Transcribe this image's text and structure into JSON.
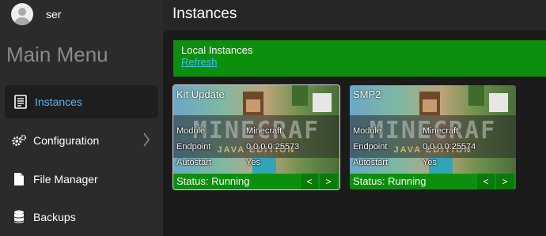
{
  "user": {
    "name": "ser"
  },
  "header": {
    "title": "Instances"
  },
  "sidebar": {
    "title": "Main Menu",
    "items": [
      {
        "label": "Instances",
        "icon": "instances-icon",
        "active": true
      },
      {
        "label": "Configuration",
        "icon": "gears-icon",
        "has_submenu": true
      },
      {
        "label": "File Manager",
        "icon": "file-icon"
      },
      {
        "label": "Backups",
        "icon": "database-icon"
      }
    ]
  },
  "banner": {
    "title": "Local Instances",
    "refresh": "Refresh"
  },
  "instances": [
    {
      "name": "Kit Update",
      "module_label": "Module",
      "module": "Minecraft",
      "endpoint_label": "Endpoint",
      "endpoint": "0.0.0.0:25573",
      "autostart_label": "Autostart",
      "autostart": "Yes",
      "status": "Status: Running",
      "prev": "<",
      "next": ">"
    },
    {
      "name": "SMP2",
      "module_label": "Module",
      "module": "Minecraft",
      "endpoint_label": "Endpoint",
      "endpoint": "0.0.0.0:25574",
      "autostart_label": "Autostart",
      "autostart": "Yes",
      "status": "Status: Running",
      "prev": "<",
      "next": ">"
    }
  ],
  "colors": {
    "accent_green": "#0c8f0c",
    "active_text": "#5fb3f0",
    "link": "#3fc0f0"
  }
}
